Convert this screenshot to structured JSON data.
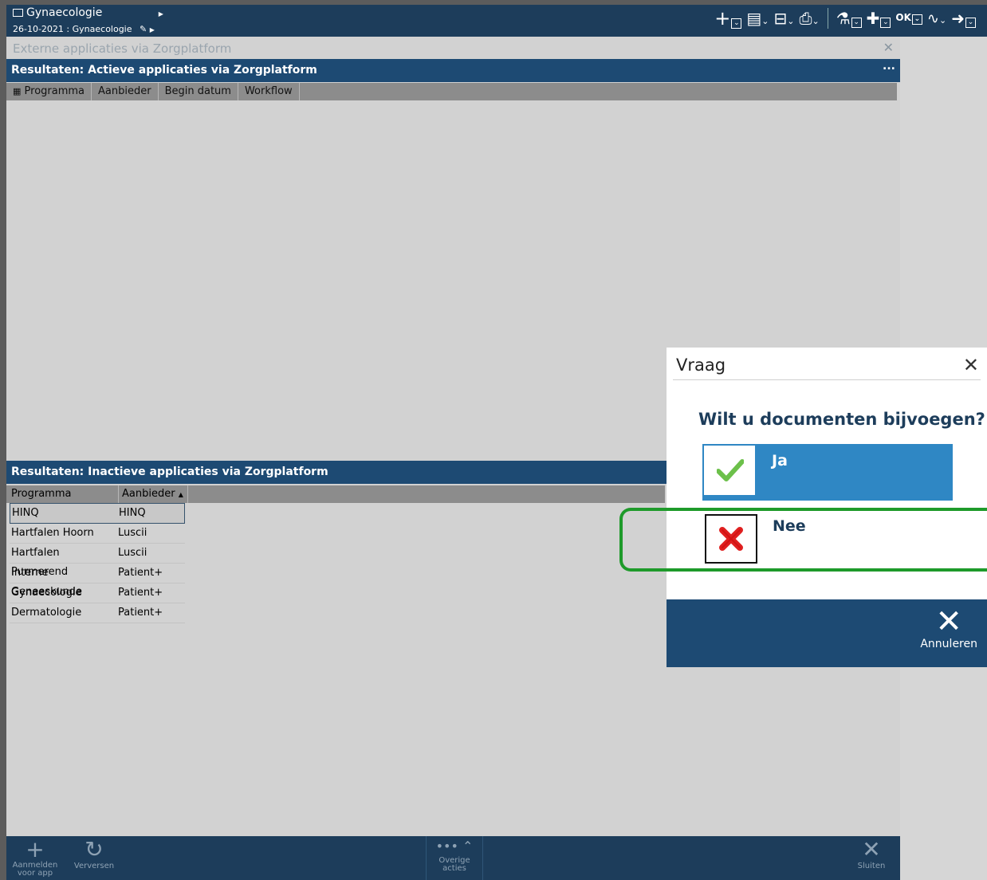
{
  "header": {
    "department": "Gynaecologie",
    "date_context": "26-10-2021 : Gynaecologie",
    "toolbar_icons": [
      "plus-icon",
      "document-icon",
      "forms-icon",
      "print-icon",
      "lab-icon",
      "medication-icon",
      "ok-icon",
      "route-icon",
      "add-item-icon"
    ]
  },
  "window": {
    "title": "Externe applicaties via Zorgplatform",
    "close": "✕"
  },
  "active_section": {
    "title": "Resultaten: Actieve applicaties via Zorgplatform",
    "more": "...",
    "columns": [
      "Programma",
      "Aanbieder",
      "Begin datum",
      "Workflow"
    ]
  },
  "inactive_section": {
    "title": "Resultaten: Inactieve applicaties via Zorgplatform",
    "columns": [
      "Programma",
      "Aanbieder"
    ],
    "rows": [
      {
        "programma": "HINQ",
        "aanbieder": "HINQ"
      },
      {
        "programma": "Hartfalen Hoorn",
        "aanbieder": "Luscii"
      },
      {
        "programma": "Hartfalen Purmerend",
        "aanbieder": "Luscii"
      },
      {
        "programma": "Interne Geneeskunde",
        "aanbieder": "Patient+"
      },
      {
        "programma": "Gynaecologie",
        "aanbieder": "Patient+"
      },
      {
        "programma": "Dermatologie",
        "aanbieder": "Patient+"
      }
    ]
  },
  "bottom_bar": {
    "register_label": "Aanmelden voor app",
    "refresh_label": "Verversen",
    "more_actions_label": "Overige acties",
    "close_label": "Sluiten"
  },
  "dialog": {
    "title": "Vraag",
    "question": "Wilt u documenten bijvoegen?",
    "yes_label": "Ja",
    "no_label": "Nee",
    "cancel_label": "Annuleren"
  },
  "colors": {
    "header_bg": "#1d3d5b",
    "section_bg": "#1d4a73",
    "yes_bg": "#2f87c4",
    "highlight": "#1e9a2a"
  }
}
